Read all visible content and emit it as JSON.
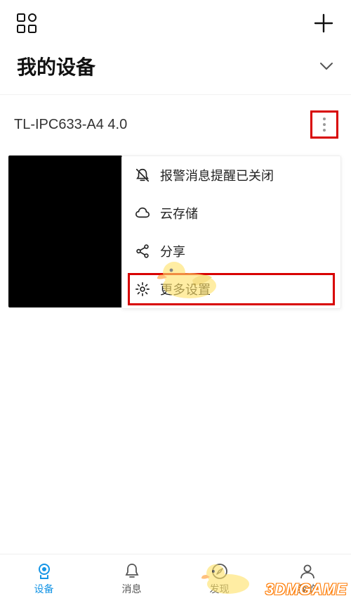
{
  "header": {
    "section_title": "我的设备"
  },
  "device": {
    "name": "TL-IPC633-A4 4.0"
  },
  "menu": {
    "items": [
      {
        "icon": "bell-off-icon",
        "label": "报警消息提醒已关闭"
      },
      {
        "icon": "cloud-icon",
        "label": "云存储"
      },
      {
        "icon": "share-icon",
        "label": "分享"
      },
      {
        "icon": "gear-icon",
        "label": "更多设置"
      }
    ]
  },
  "tabs": {
    "device": "设备",
    "message": "消息",
    "discover": "发现",
    "mine": "我的"
  },
  "watermark": "3DMGAME"
}
